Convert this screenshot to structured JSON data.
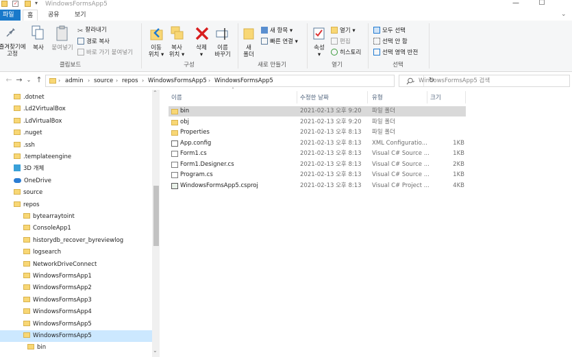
{
  "window": {
    "title": "WindowsFormsApp5",
    "controls": [
      "minimize-icon",
      "maximize-icon"
    ]
  },
  "ribbon_tabs": [
    {
      "label": "파일"
    },
    {
      "label": "홈"
    },
    {
      "label": "공유"
    },
    {
      "label": "보기"
    }
  ],
  "ribbon": {
    "clipboard": {
      "pin_label": "즐겨찾기에\n고정",
      "copy_label": "복사",
      "paste_label": "붙여넣기",
      "cut_label": "잘라내기",
      "copy_path_label": "경로 복사",
      "paste_shortcut_label": "바로 가기 붙여넣기",
      "group_label": "클립보드"
    },
    "organize": {
      "move_label": "이동\n위치 ▾",
      "copyto_label": "복사\n위치 ▾",
      "delete_label": "삭제\n▾",
      "rename_label": "이름\n바꾸기",
      "group_label": "구성"
    },
    "new": {
      "new_folder_label": "새\n폴더",
      "new_item_label": "새 항목 ▾",
      "easy_access_label": "빠른 연결 ▾",
      "group_label": "새로 만들기"
    },
    "open": {
      "properties_label": "속성\n▾",
      "open_label": "열기 ▾",
      "edit_label": "편집",
      "history_label": "히스토리",
      "group_label": "열기"
    },
    "select": {
      "select_all_label": "모두 선택",
      "select_none_label": "선택 안 함",
      "invert_label": "선택 영역 반전",
      "group_label": "선택"
    }
  },
  "address": {
    "crumbs": [
      "admin",
      "source",
      "repos",
      "WindowsFormsApp5",
      "WindowsFormsApp5"
    ],
    "search_placeholder": "WindowsFormsApp5 검색"
  },
  "nav_pane": {
    "items": [
      {
        "label": ".dotnet",
        "icon": "folder-icon",
        "indent": 1
      },
      {
        "label": ".Ld2VirtualBox",
        "icon": "folder-icon",
        "indent": 1
      },
      {
        "label": ".LdVirtualBox",
        "icon": "folder-icon",
        "indent": 1
      },
      {
        "label": ".nuget",
        "icon": "folder-icon",
        "indent": 1
      },
      {
        "label": ".ssh",
        "icon": "folder-icon",
        "indent": 1
      },
      {
        "label": ".templateengine",
        "icon": "folder-icon",
        "indent": 1
      },
      {
        "label": "3D 개체",
        "icon": "3d-objects-icon",
        "indent": 1
      },
      {
        "label": "OneDrive",
        "icon": "onedrive-icon",
        "indent": 1
      },
      {
        "label": "source",
        "icon": "folder-icon",
        "indent": 1
      },
      {
        "label": "repos",
        "icon": "folder-icon",
        "indent": 2
      },
      {
        "label": "bytearraytoint",
        "icon": "folder-icon",
        "indent": 3
      },
      {
        "label": "ConsoleApp1",
        "icon": "folder-icon",
        "indent": 3
      },
      {
        "label": "historydb_recover_byreviewlog",
        "icon": "folder-icon",
        "indent": 3
      },
      {
        "label": "logsearch",
        "icon": "folder-icon",
        "indent": 3
      },
      {
        "label": "NetworkDriveConnect",
        "icon": "folder-icon",
        "indent": 3
      },
      {
        "label": "WindowsFormsApp1",
        "icon": "folder-icon",
        "indent": 3
      },
      {
        "label": "WindowsFormsApp2",
        "icon": "folder-icon",
        "indent": 3
      },
      {
        "label": "WindowsFormsApp3",
        "icon": "folder-icon",
        "indent": 3
      },
      {
        "label": "WindowsFormsApp4",
        "icon": "folder-icon",
        "indent": 3
      },
      {
        "label": "WindowsFormsApp5",
        "icon": "folder-icon",
        "indent": 3
      },
      {
        "label": "WindowsFormsApp5",
        "icon": "folder-icon",
        "indent": 4,
        "selected": true
      },
      {
        "label": "bin",
        "icon": "folder-icon",
        "indent": 5
      }
    ]
  },
  "file_list": {
    "columns": [
      "이름",
      "수정한 날짜",
      "유형",
      "크기"
    ],
    "rows": [
      {
        "name": "bin",
        "date": "2021-02-13 오후 9:20",
        "type": "파일 폴더",
        "size": "",
        "icon": "folder",
        "selected": true
      },
      {
        "name": "obj",
        "date": "2021-02-13 오후 9:20",
        "type": "파일 폴더",
        "size": "",
        "icon": "folder"
      },
      {
        "name": "Properties",
        "date": "2021-02-13 오후 8:13",
        "type": "파일 폴더",
        "size": "",
        "icon": "folder"
      },
      {
        "name": "App.config",
        "date": "2021-02-13 오후 8:13",
        "type": "XML Configuratio...",
        "size": "1KB",
        "icon": "config"
      },
      {
        "name": "Form1.cs",
        "date": "2021-02-13 오후 8:13",
        "type": "Visual C# Source ...",
        "size": "1KB",
        "icon": "cs"
      },
      {
        "name": "Form1.Designer.cs",
        "date": "2021-02-13 오후 8:13",
        "type": "Visual C# Source ...",
        "size": "2KB",
        "icon": "cs"
      },
      {
        "name": "Program.cs",
        "date": "2021-02-13 오후 8:13",
        "type": "Visual C# Source ...",
        "size": "1KB",
        "icon": "cs"
      },
      {
        "name": "WindowsFormsApp5.csproj",
        "date": "2021-02-13 오후 8:13",
        "type": "Visual C# Project ...",
        "size": "4KB",
        "icon": "csproj"
      }
    ]
  }
}
